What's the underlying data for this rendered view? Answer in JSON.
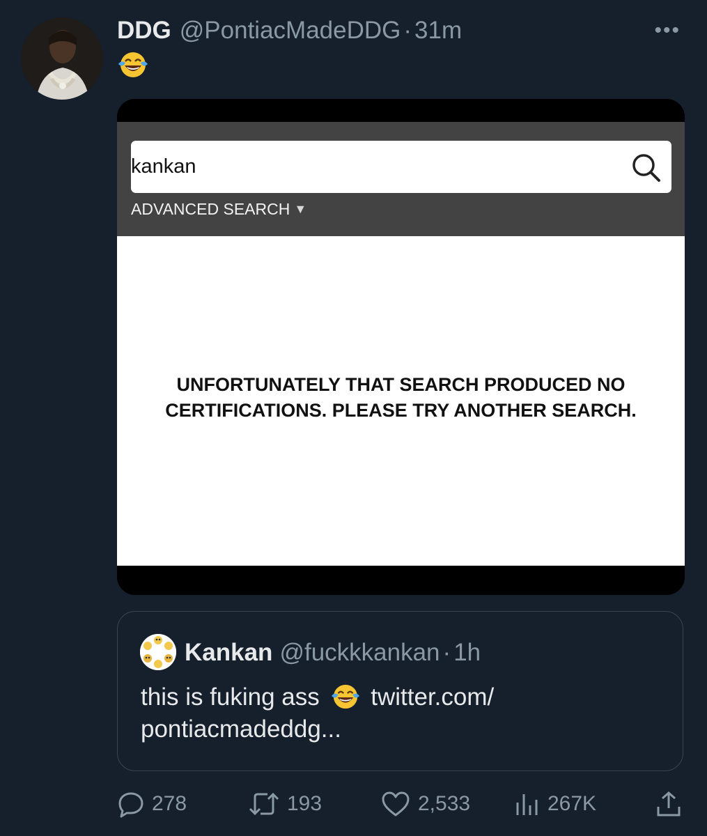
{
  "tweet": {
    "author_name": "DDG",
    "author_handle": "@PontiacMadeDDG",
    "separator": "·",
    "time": "31m",
    "more_icon": "more-horizontal-icon",
    "text_emoji": "face-with-tears-of-joy"
  },
  "media": {
    "search_value": "kankan",
    "search_icon": "search-icon",
    "advanced_search_label": "ADVANCED SEARCH",
    "advanced_search_arrow": "▼",
    "no_results_line1": "UNFORTUNATELY THAT SEARCH PRODUCED NO",
    "no_results_line2": "CERTIFICATIONS. PLEASE TRY ANOTHER SEARCH."
  },
  "quote": {
    "author_name": "Kankan",
    "author_handle": "@fuckkkankan",
    "separator": "·",
    "time": "1h",
    "text_part1": "this is fuking ass",
    "text_part2": "twitter.com/",
    "text_part3": "pontiacmadeddg..."
  },
  "actions": {
    "replies": "278",
    "retweets": "193",
    "likes": "2,533",
    "views": "267K"
  },
  "colors": {
    "background": "#16202c",
    "secondary_text": "#8b98a5",
    "media_bar": "#444343"
  }
}
